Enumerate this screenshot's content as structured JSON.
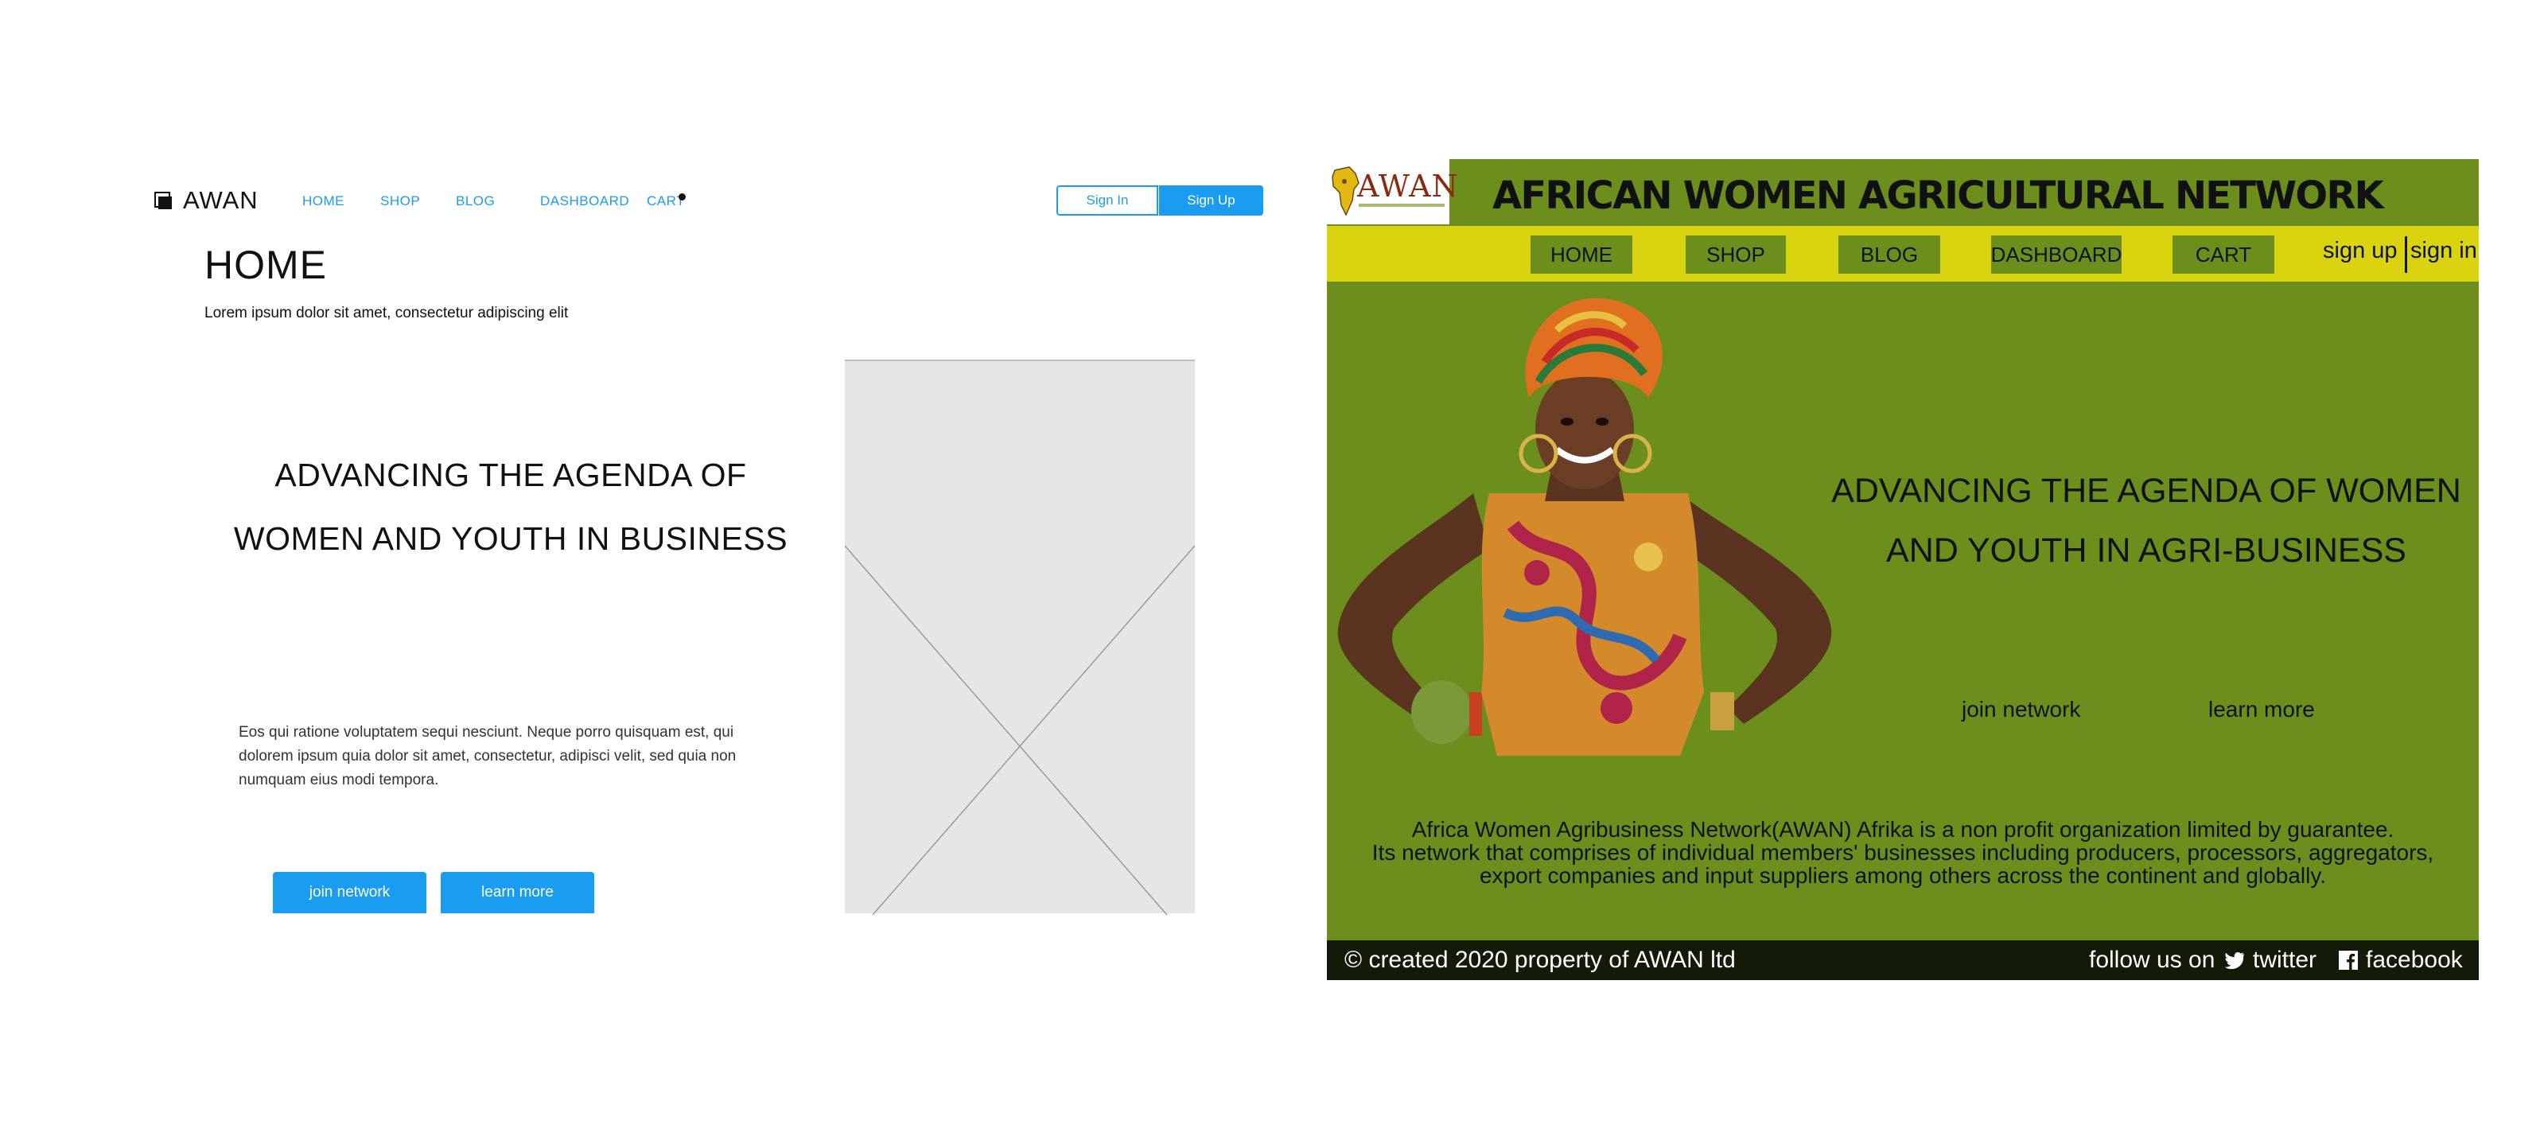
{
  "wireframe": {
    "logo_text": "AWAN",
    "nav": [
      "HOME",
      "SHOP",
      "BLOG",
      "DASHBOARD",
      "CART"
    ],
    "sign_in": "Sign In",
    "sign_up": "Sign Up",
    "page_title": "HOME",
    "subtitle": "Lorem ipsum dolor sit amet, consectetur adipiscing elit",
    "headline_1": "ADVANCING THE AGENDA OF",
    "headline_2": "WOMEN AND YOUTH IN BUSINESS",
    "paragraph": "Eos qui ratione voluptatem sequi nesciunt. Neque porro quisquam est, qui dolorem ipsum quia dolor sit amet, consectetur, adipisci velit, sed quia non numquam eius modi tempora.",
    "btn_join": "join network",
    "btn_learn": "learn more"
  },
  "mockup": {
    "logo_text": "AWAN",
    "title": "AFRICAN WOMEN AGRICULTURAL NETWORK",
    "nav": [
      "HOME",
      "SHOP",
      "BLOG",
      "DASHBOARD",
      "CART"
    ],
    "sign_up": "sign up",
    "sign_in": "sign in",
    "headline_1": "ADVANCING THE AGENDA OF WOMEN",
    "headline_2": "AND YOUTH IN AGRI-BUSINESS",
    "link_join": "join network",
    "link_learn": "learn more",
    "desc_1": "Africa Women Agribusiness Network(AWAN) Afrika is a non profit organization limited by guarantee.",
    "desc_2": "Its network that comprises of individual members' businesses including producers, processors, aggregators,",
    "desc_3": "export companies and input suppliers among others across the continent and globally.",
    "copyright": "© created 2020 property of AWAN ltd",
    "follow": "follow us on",
    "twitter": "twitter",
    "facebook": "facebook",
    "colors": {
      "background": "#6b8e1c",
      "navbar": "#d9d40f",
      "footer": "#141a08"
    }
  }
}
